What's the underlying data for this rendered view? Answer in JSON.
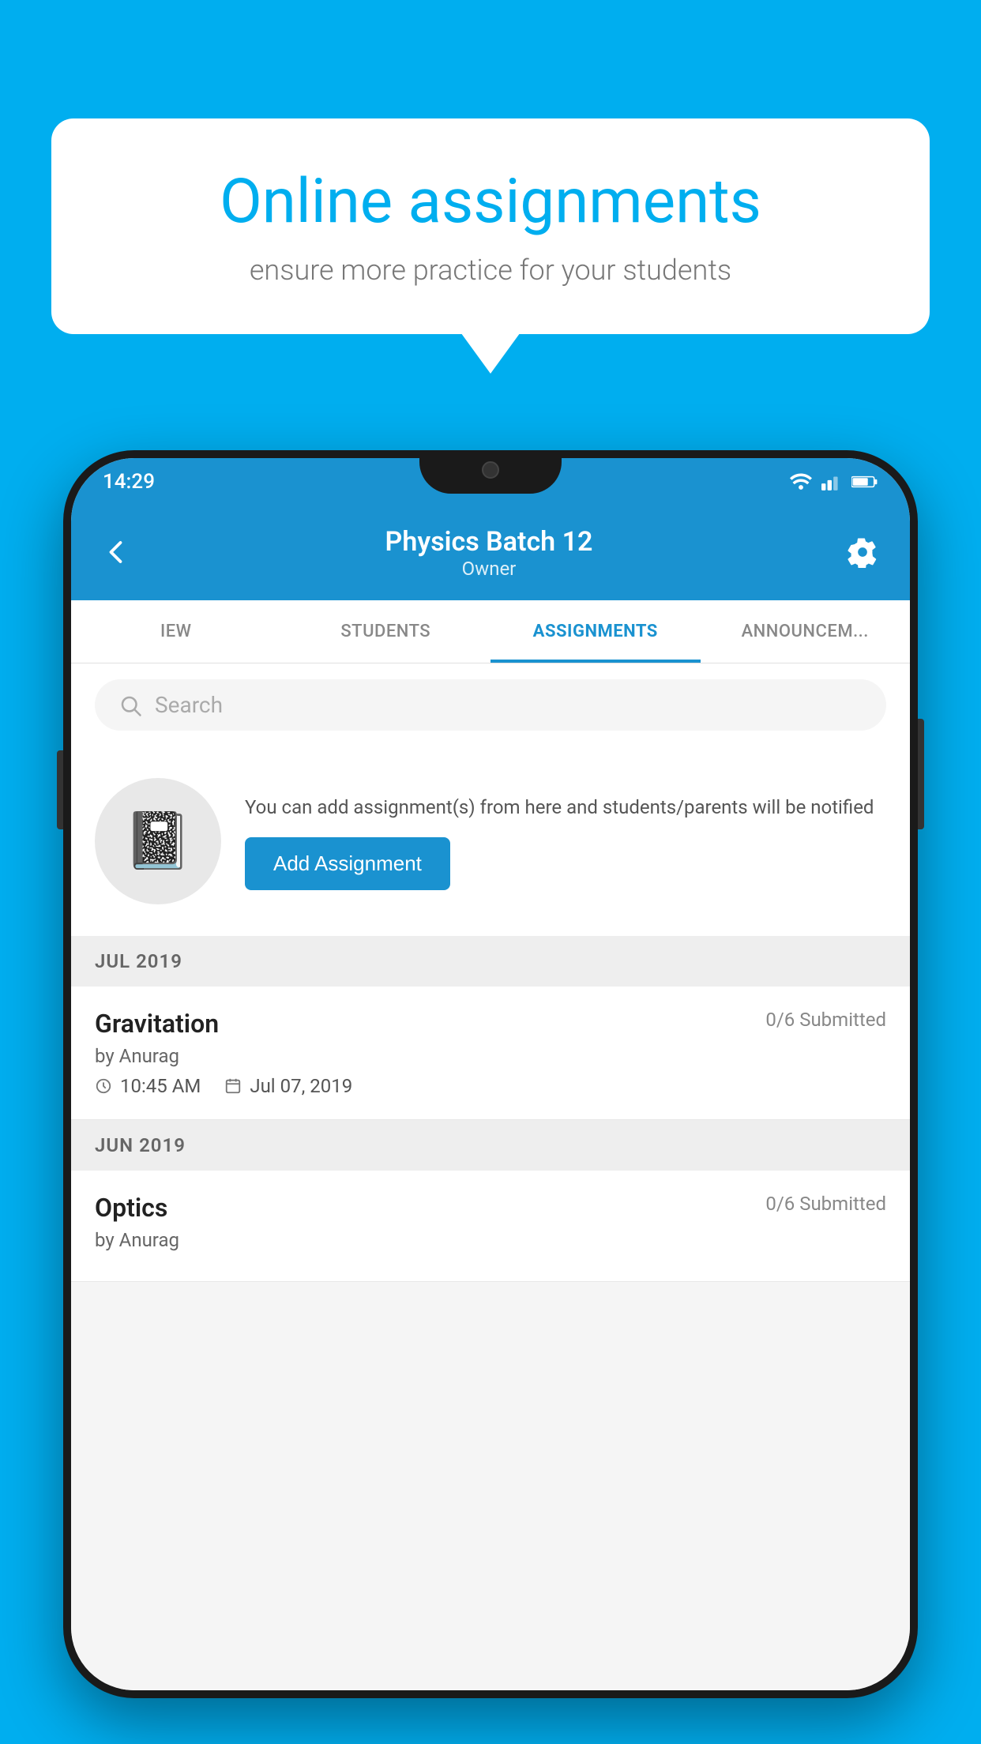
{
  "background_color": "#00AEEF",
  "speech_bubble": {
    "title": "Online assignments",
    "subtitle": "ensure more practice for your students"
  },
  "status_bar": {
    "time": "14:29",
    "icons": [
      "wifi",
      "signal",
      "battery"
    ]
  },
  "header": {
    "title": "Physics Batch 12",
    "subtitle": "Owner",
    "back_label": "Back",
    "settings_label": "Settings"
  },
  "tabs": [
    {
      "label": "IEW",
      "active": false
    },
    {
      "label": "STUDENTS",
      "active": false
    },
    {
      "label": "ASSIGNMENTS",
      "active": true
    },
    {
      "label": "ANNOUNCEM...",
      "active": false
    }
  ],
  "search": {
    "placeholder": "Search"
  },
  "add_assignment_card": {
    "description": "You can add assignment(s) from here and students/parents will be notified",
    "button_label": "Add Assignment"
  },
  "sections": [
    {
      "label": "JUL 2019",
      "assignments": [
        {
          "name": "Gravitation",
          "submitted": "0/6 Submitted",
          "by": "by Anurag",
          "time": "10:45 AM",
          "date": "Jul 07, 2019"
        }
      ]
    },
    {
      "label": "JUN 2019",
      "assignments": [
        {
          "name": "Optics",
          "submitted": "0/6 Submitted",
          "by": "by Anurag",
          "time": "",
          "date": ""
        }
      ]
    }
  ]
}
